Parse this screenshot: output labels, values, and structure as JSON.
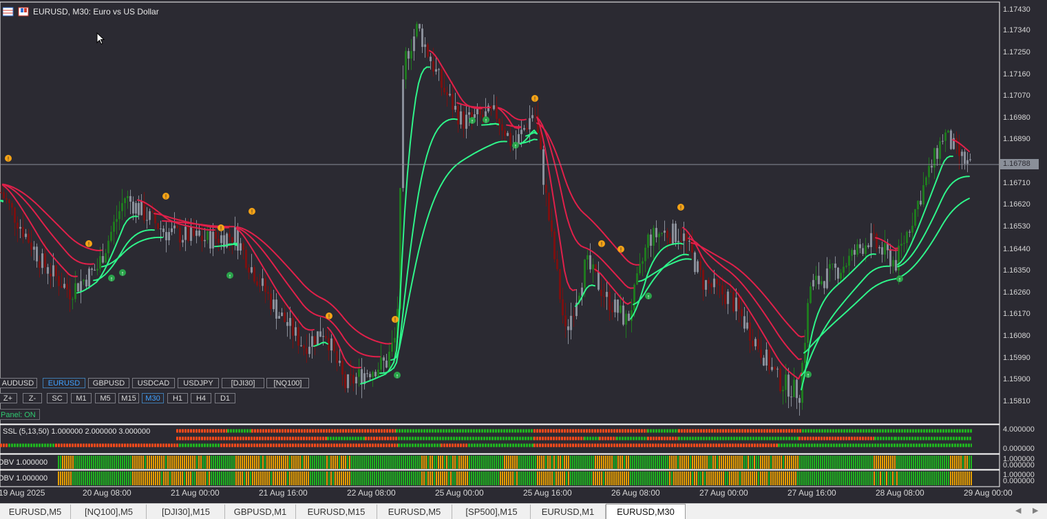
{
  "window": {
    "symbol_title": "EURUSD, M30:  Euro vs US Dollar"
  },
  "price_axis": {
    "labels": [
      "1.17430",
      "1.17340",
      "1.17250",
      "1.17160",
      "1.17070",
      "1.16980",
      "1.16890",
      "1.16710",
      "1.16620",
      "1.16530",
      "1.16440",
      "1.16350",
      "1.16260",
      "1.16170",
      "1.16080",
      "1.15990",
      "1.15900",
      "1.15810"
    ],
    "current_price": "1.16788"
  },
  "symbol_buttons": [
    {
      "label": "AUDUSD",
      "active": false
    },
    {
      "label": "EURUSD",
      "active": true
    },
    {
      "label": "GBPUSD",
      "active": false
    },
    {
      "label": "USDCAD",
      "active": false
    },
    {
      "label": "USDJPY",
      "active": false
    },
    {
      "label": "[DJI30]",
      "active": false
    },
    {
      "label": "[NQ100]",
      "active": false
    }
  ],
  "timeframe_buttons": [
    {
      "label": "Z+",
      "active": false
    },
    {
      "label": "Z-",
      "active": false
    },
    {
      "label": "SC",
      "active": false
    },
    {
      "label": "M1",
      "active": false
    },
    {
      "label": "M5",
      "active": false
    },
    {
      "label": "M15",
      "active": false
    },
    {
      "label": "M30",
      "active": true
    },
    {
      "label": "H1",
      "active": false
    },
    {
      "label": "H4",
      "active": false
    },
    {
      "label": "D1",
      "active": false
    }
  ],
  "panel_toggle": "Panel: ON",
  "indicators": {
    "ssl": {
      "label": "SSL (5,13,50) 1.000000 2.000000 3.000000",
      "scale_top": "4.000000",
      "scale_bottom": "0.000000"
    },
    "obv1": {
      "label": "OBV 1.000000",
      "scale_top": "1.000000",
      "scale_bottom": "0.000000"
    },
    "obv2": {
      "label": "OBV 1.000000",
      "scale_top": "1.000000",
      "scale_bottom": "0.000000"
    }
  },
  "time_axis": [
    "19 Aug 2025",
    "20 Aug 08:00",
    "21 Aug 00:00",
    "21 Aug 16:00",
    "22 Aug 08:00",
    "25 Aug 00:00",
    "25 Aug 16:00",
    "26 Aug 08:00",
    "27 Aug 00:00",
    "27 Aug 16:00",
    "28 Aug 08:00",
    "29 Aug 00:00"
  ],
  "tabs": [
    {
      "label": "EURUSD,M5",
      "active": false
    },
    {
      "label": "[NQ100],M5",
      "active": false
    },
    {
      "label": "[DJI30],M15",
      "active": false
    },
    {
      "label": "GBPUSD,M1",
      "active": false
    },
    {
      "label": "EURUSD,M15",
      "active": false
    },
    {
      "label": "EURUSD,M5",
      "active": false
    },
    {
      "label": "[SP500],M15",
      "active": false
    },
    {
      "label": "EURUSD,M1",
      "active": false
    },
    {
      "label": "EURUSD,M30",
      "active": true
    }
  ],
  "colors": {
    "background": "#2b2a32",
    "bull_candle": "#1f7a1f",
    "bear_candle": "#7a1010",
    "neutral_candle": "#8a8f9a",
    "ssl_up_line": "#2ff58a",
    "ssl_down_line": "#e0204a",
    "signal_marker": "#f5a316",
    "indicator_green": "#1fb51f",
    "indicator_red": "#ff4a1a",
    "obv_orange": "#e8a000"
  },
  "chart_data": {
    "type": "candlestick",
    "symbol": "EURUSD",
    "timeframe": "M30",
    "ylim": [
      1.1575,
      1.175
    ],
    "price_path": [
      [
        0,
        1.167
      ],
      [
        60,
        1.164
      ],
      [
        100,
        1.1628
      ],
      [
        140,
        1.1638
      ],
      [
        180,
        1.1668
      ],
      [
        220,
        1.1658
      ],
      [
        240,
        1.1653
      ],
      [
        300,
        1.165
      ],
      [
        340,
        1.1652
      ],
      [
        360,
        1.164
      ],
      [
        400,
        1.162
      ],
      [
        440,
        1.1605
      ],
      [
        470,
        1.1612
      ],
      [
        500,
        1.1588
      ],
      [
        530,
        1.1594
      ],
      [
        560,
        1.1598
      ],
      [
        575,
        1.161
      ],
      [
        585,
        1.1725
      ],
      [
        605,
        1.174
      ],
      [
        640,
        1.1715
      ],
      [
        670,
        1.17
      ],
      [
        700,
        1.1702
      ],
      [
        720,
        1.1703
      ],
      [
        745,
        1.1689
      ],
      [
        775,
        1.1705
      ],
      [
        800,
        1.165
      ],
      [
        820,
        1.161
      ],
      [
        850,
        1.164
      ],
      [
        880,
        1.1625
      ],
      [
        910,
        1.1615
      ],
      [
        940,
        1.165
      ],
      [
        960,
        1.1653
      ],
      [
        990,
        1.1652
      ],
      [
        1020,
        1.1632
      ],
      [
        1060,
        1.1625
      ],
      [
        1100,
        1.1605
      ],
      [
        1130,
        1.159
      ],
      [
        1160,
        1.1585
      ],
      [
        1175,
        1.163
      ],
      [
        1220,
        1.1638
      ],
      [
        1260,
        1.165
      ],
      [
        1300,
        1.164
      ],
      [
        1340,
        1.1672
      ],
      [
        1370,
        1.1695
      ],
      [
        1390,
        1.1686
      ],
      [
        1410,
        1.168
      ]
    ]
  }
}
